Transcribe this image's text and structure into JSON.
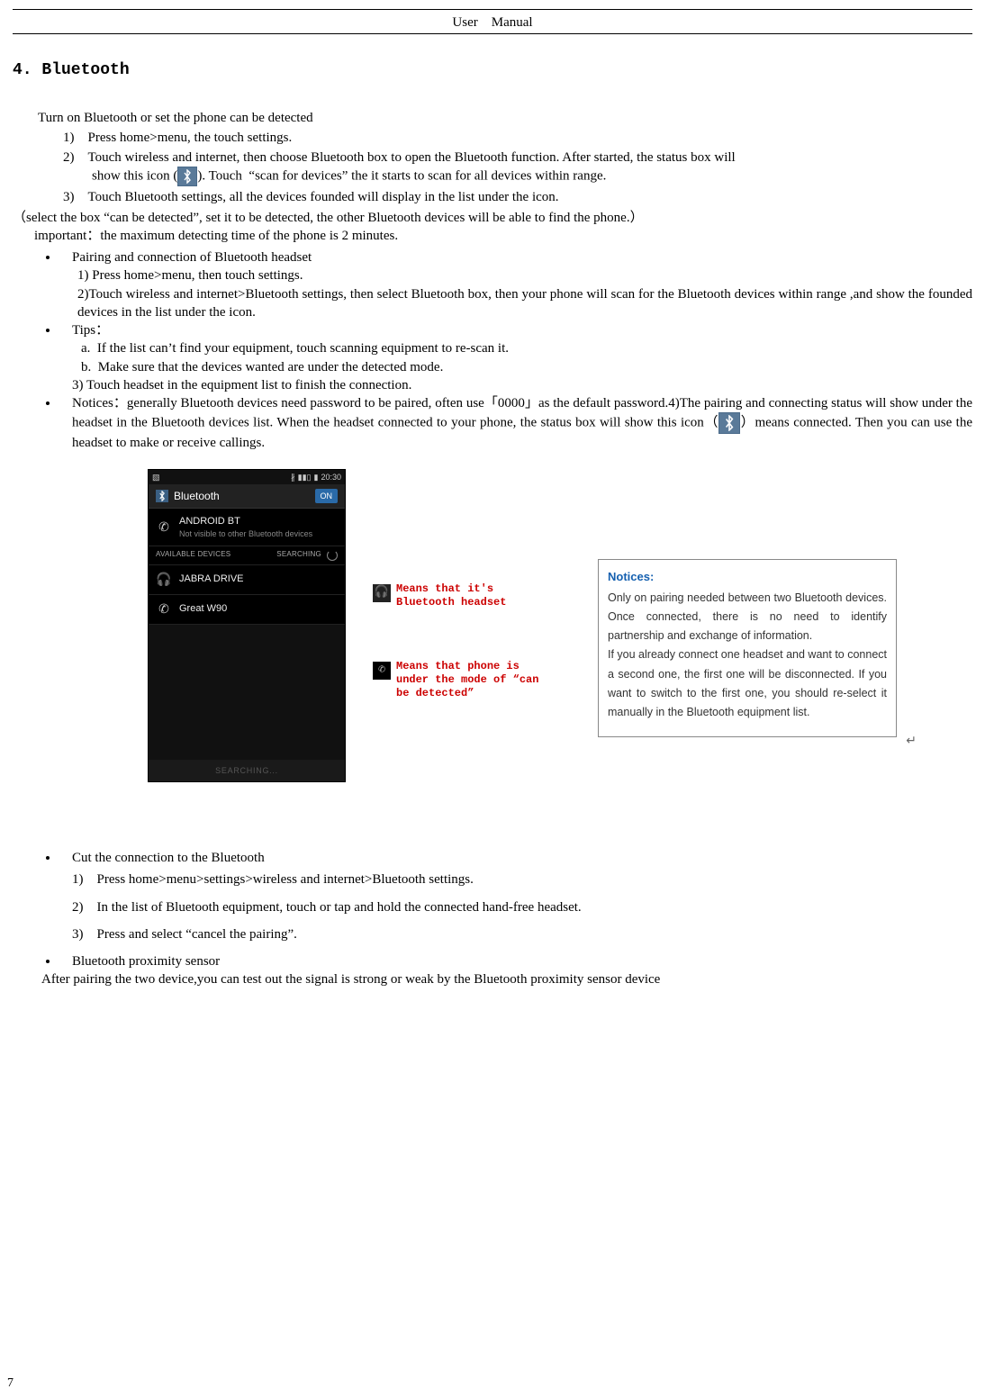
{
  "header": "User Manual",
  "section_title": "4. Bluetooth",
  "intro": "Turn on Bluetooth or set the phone can be detected",
  "steps_top": {
    "s1": "Press home>menu, the touch settings.",
    "s2a": "Touch wireless and internet, then choose Bluetooth box to open the Bluetooth function. After started, the status box will",
    "s2b_pre": "show this icon (",
    "s2b_post": "). Touch  “scan for devices” the it starts to scan for all devices within range.",
    "s3": "Touch Bluetooth settings, all the devices founded will display in the list under the icon."
  },
  "paren_note": "（select the box “can be detected”, set it to be detected, the other Bluetooth devices will be able to find the phone.）",
  "important": "important：the maximum detecting time of the phone is 2 minutes.",
  "bullets": {
    "pairing_title": "Pairing and connection of Bluetooth headset",
    "pairing_1": "1) Press home>menu, then touch settings.",
    "pairing_2": "2)Touch wireless and internet>Bluetooth settings, then select Bluetooth box, then your phone will scan for the Bluetooth devices within range ,and show the founded devices in the list under the icon.",
    "tips_title": "Tips：",
    "tips_a": "a.  If the list can’t find your equipment, touch scanning equipment to re-scan it.",
    "tips_b": "b.  Make sure that the devices wanted are under the detected mode.",
    "tips_3": "3) Touch headset in the equipment list to finish the connection.",
    "notices_pre": "Notices：generally Bluetooth devices need password to be paired, often use「0000」as the default password.4)The pairing and connecting status will show under the headset in the Bluetooth devices list. When the headset connected to your phone, the status box will show this icon（",
    "notices_post": "）means connected. Then you can use the headset to make or receive callings."
  },
  "phone": {
    "time": "20:30",
    "bt_label": "Bluetooth",
    "toggle": "ON",
    "my_name": "ANDROID BT",
    "my_sub": "Not visible to other Bluetooth devices",
    "avail": "AVAILABLE DEVICES",
    "searching_label": "SEARCHING",
    "dev1": "JABRA DRIVE",
    "dev2": "Great W90",
    "searching_footer": "SEARCHING..."
  },
  "callouts": {
    "c1": "Means that it's Bluetooth headset",
    "c2": "Means that phone is under the mode of “can be detected”"
  },
  "notices_box": {
    "title": "Notices:",
    "p1": "Only on pairing needed between two Bluetooth devices. Once connected, there is no need to identify partnership and exchange of information.",
    "p2": "If you already connect one headset and want to connect a second one, the first one will be disconnected. If you want to switch to the first one, you should re-select it manually in the Bluetooth equipment list."
  },
  "cut": {
    "title": "Cut the connection to the Bluetooth",
    "s1": "Press home>menu>settings>wireless and internet>Bluetooth settings.",
    "s2": "In the list of Bluetooth equipment, touch or tap and hold the connected hand-free headset.",
    "s3": "Press and select “cancel the pairing”."
  },
  "prox": {
    "title": "Bluetooth proximity sensor",
    "text": "After pairing the two device,you can test out the signal is strong or weak by the Bluetooth proximity sensor device"
  },
  "page_num": "7"
}
